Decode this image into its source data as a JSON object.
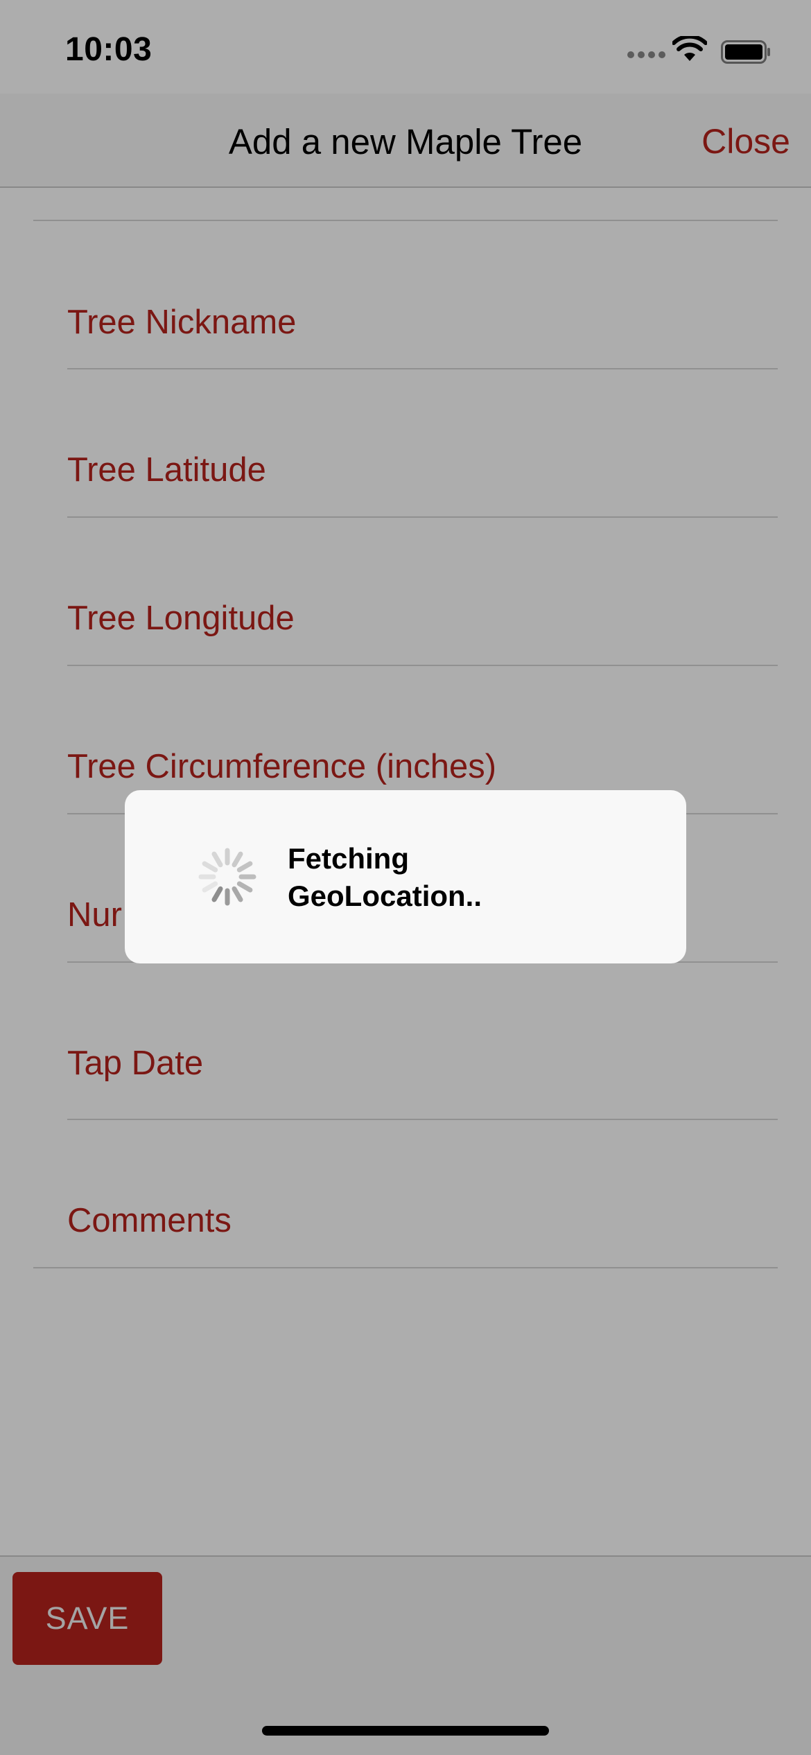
{
  "status_bar": {
    "time": "10:03"
  },
  "nav": {
    "title": "Add a new Maple Tree",
    "close_label": "Close"
  },
  "form": {
    "fields": [
      {
        "placeholder": "Tree Nickname"
      },
      {
        "placeholder": "Tree Latitude"
      },
      {
        "placeholder": "Tree Longitude"
      },
      {
        "placeholder": "Tree Circumference (inches)"
      },
      {
        "placeholder": "Nur"
      },
      {
        "placeholder": "Tap Date"
      },
      {
        "placeholder": "Comments"
      }
    ]
  },
  "actions": {
    "save_label": "SAVE"
  },
  "loading": {
    "message": "Fetching GeoLocation.."
  },
  "colors": {
    "accent": "#b5231c",
    "dim_overlay": "rgba(0,0,0,0.32)"
  }
}
